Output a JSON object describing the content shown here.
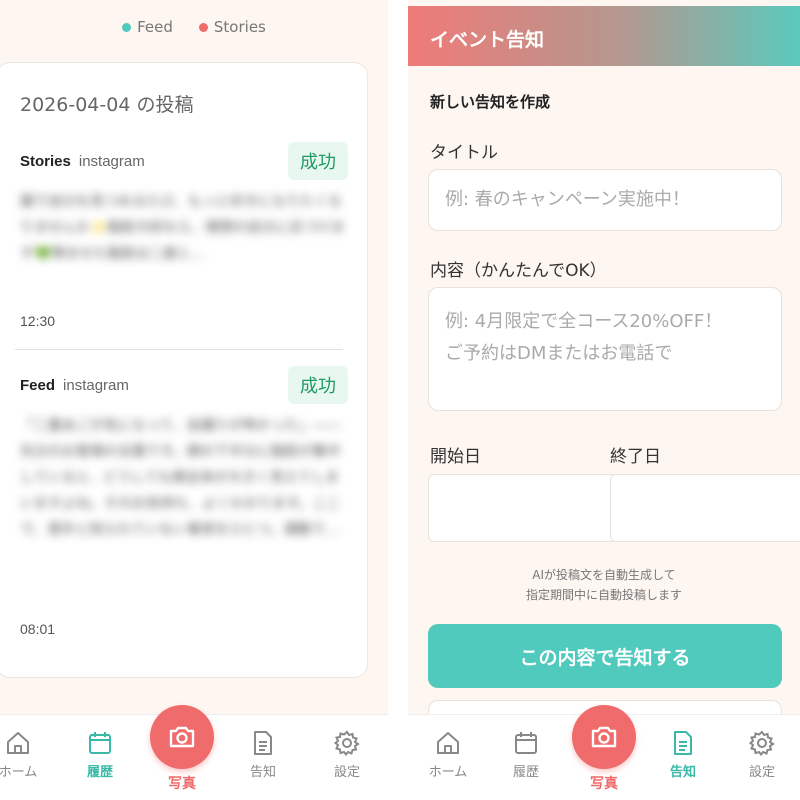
{
  "left": {
    "legend": [
      {
        "label": "Feed",
        "color": "#4fcabd"
      },
      {
        "label": "Stories",
        "color": "#f06b6b"
      }
    ],
    "date_title": "2026-04-04 の投稿",
    "posts": [
      {
        "type": "Stories",
        "platform": "instagram",
        "status": "成功",
        "text": "鏡で自分を見つめるたび、もっと好きになりたくなりませんか✨脂肪冷却なら、理想の自分に近づけます💚弾ませた脂肪は二度と…",
        "time": "12:30"
      },
      {
        "type": "Feed",
        "platform": "instagram",
        "status": "成功",
        "text": "「二重あごが気になって、自撮りが怖かった」――先日のお客様の言葉です。顔の下半分に脂肪が集中していると、どうしても顔全体が大きく見えてしまいますよね。そのお気持ち、よくわかります。ここで、意外と知られていない事実をひとつ。運動で…",
        "time": "08:01"
      }
    ],
    "nav": {
      "home": "ホーム",
      "history": "履歴",
      "photo": "写真",
      "notice": "告知",
      "settings": "設定"
    }
  },
  "right": {
    "header_title": "イベント告知",
    "form_heading": "新しい告知を作成",
    "title_label": "タイトル",
    "title_placeholder": "例: 春のキャンペーン実施中！",
    "content_label": "内容（かんたんでOK）",
    "content_placeholder_line1": "例: 4月限定で全コース20%OFF！",
    "content_placeholder_line2": "ご予約はDMまたはお電話で",
    "start_label": "開始日",
    "end_label": "終了日",
    "info_line1": "AIが投稿文を自動生成して",
    "info_line2": "指定期間中に自動投稿します",
    "submit_label": "この内容で告知する",
    "nav": {
      "home": "ホーム",
      "history": "履歴",
      "photo": "写真",
      "notice": "告知",
      "settings": "設定"
    }
  },
  "colors": {
    "accent_teal": "#4fcabd",
    "accent_coral": "#f06b6b",
    "success_green": "#1f9a64"
  }
}
